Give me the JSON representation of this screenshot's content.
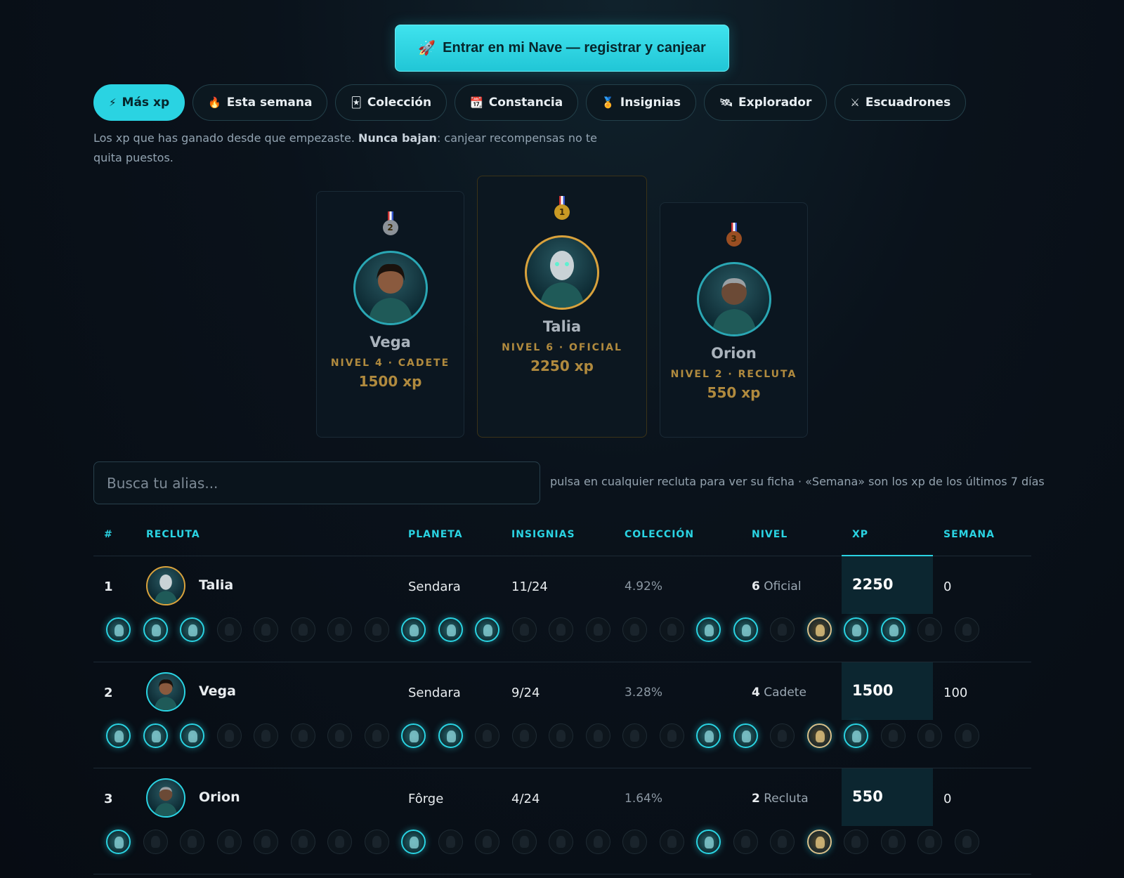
{
  "cta": {
    "icon": "🚀",
    "label": "Entrar en mi Nave — registrar y canjear"
  },
  "tabs": [
    {
      "icon": "⚡",
      "label": "Más xp",
      "active": true
    },
    {
      "icon": "🔥",
      "label": "Esta semana"
    },
    {
      "icon": "🃏",
      "label": "Colección"
    },
    {
      "icon": "📆",
      "label": "Constancia"
    },
    {
      "icon": "🏅",
      "label": "Insignias"
    },
    {
      "icon": "🛰",
      "label": "Explorador"
    },
    {
      "icon": "⚔",
      "label": "Escuadrones"
    }
  ],
  "description": {
    "before": "Los xp que has ganado desde que empezaste. ",
    "bold": "Nunca bajan",
    "after": ": canjear recompensas no te quita puestos."
  },
  "podium": {
    "second": {
      "medal": "2",
      "name": "Vega",
      "level": "NIVEL 4 · CADETE",
      "xp": "1500 xp"
    },
    "first": {
      "medal": "1",
      "name": "Talia",
      "level": "NIVEL 6 · OFICIAL",
      "xp": "2250 xp"
    },
    "third": {
      "medal": "3",
      "name": "Orion",
      "level": "NIVEL 2 · RECLUTA",
      "xp": "550 xp"
    }
  },
  "search": {
    "placeholder": "Busca tu alias..."
  },
  "hint": "pulsa en cualquier recluta para ver su ficha · «Semana» son los xp de los últimos 7 días",
  "table": {
    "headers": {
      "rank": "#",
      "recruit": "RECLUTA",
      "planet": "PLANETA",
      "badges": "INSIGNIAS",
      "collection": "COLECCIÓN",
      "level": "NIVEL",
      "xp": "XP",
      "week": "SEMANA"
    },
    "rows": [
      {
        "rank": "1",
        "name": "Talia",
        "planet": "Sendara",
        "badges": "11/24",
        "collection": "4.92%",
        "level_num": "6",
        "level_name": "Oficial",
        "xp": "2250",
        "week": "0",
        "badge_state": [
          1,
          1,
          1,
          0,
          0,
          0,
          0,
          0,
          1,
          1,
          1,
          0,
          0,
          0,
          0,
          0,
          1,
          1,
          0,
          2,
          1,
          1,
          0,
          0
        ]
      },
      {
        "rank": "2",
        "name": "Vega",
        "planet": "Sendara",
        "badges": "9/24",
        "collection": "3.28%",
        "level_num": "4",
        "level_name": "Cadete",
        "xp": "1500",
        "week": "100",
        "badge_state": [
          1,
          1,
          1,
          0,
          0,
          0,
          0,
          0,
          1,
          1,
          0,
          0,
          0,
          0,
          0,
          0,
          1,
          1,
          0,
          2,
          1,
          0,
          0,
          0
        ]
      },
      {
        "rank": "3",
        "name": "Orion",
        "planet": "Fôrge",
        "badges": "4/24",
        "collection": "1.64%",
        "level_num": "2",
        "level_name": "Recluta",
        "xp": "550",
        "week": "0",
        "badge_state": [
          1,
          0,
          0,
          0,
          0,
          0,
          0,
          0,
          1,
          0,
          0,
          0,
          0,
          0,
          0,
          0,
          1,
          0,
          0,
          2,
          0,
          0,
          0,
          0
        ]
      }
    ]
  },
  "colors": {
    "accent": "#2ad3e2",
    "gold": "#b08a3e",
    "background": "#070c13"
  }
}
